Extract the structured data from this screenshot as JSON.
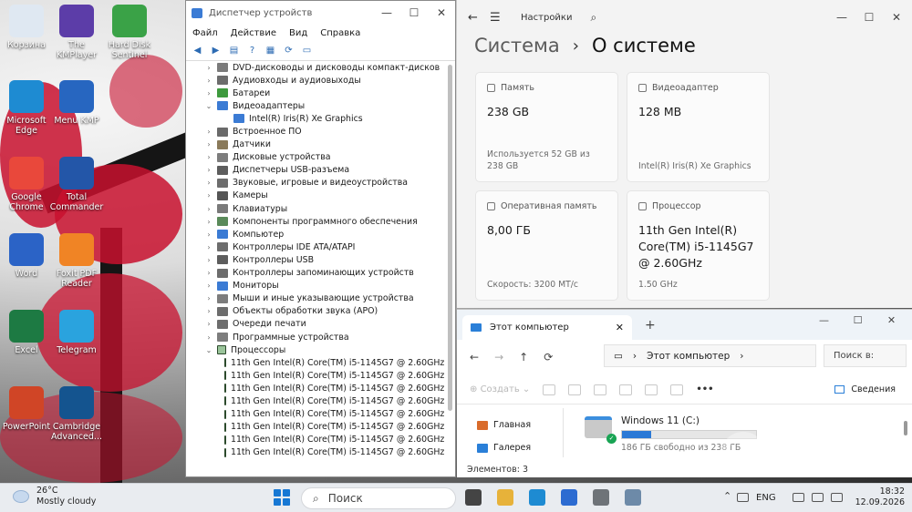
{
  "desktop": {
    "icons": [
      {
        "label": "Корзина",
        "color": "#dfe8f2"
      },
      {
        "label": "The KMPlayer",
        "color": "#5c3da8"
      },
      {
        "label": "Hard Disk Sentinel",
        "color": "#3aa247"
      },
      {
        "label": "Microsoft Edge",
        "color": "#1e8bd2"
      },
      {
        "label": "Menu KMP",
        "color": "#2766c0"
      },
      {
        "label": "Google Chrome",
        "color": "#e9483b"
      },
      {
        "label": "Total Commander",
        "color": "#2356a8"
      },
      {
        "label": "Word",
        "color": "#2b63c6"
      },
      {
        "label": "Foxit PDF Reader",
        "color": "#f08425"
      },
      {
        "label": "Excel",
        "color": "#1d7a43"
      },
      {
        "label": "Telegram",
        "color": "#2aa3de"
      },
      {
        "label": "PowerPoint",
        "color": "#d04526"
      },
      {
        "label": "Cambridge Advanced...",
        "color": "#14548f"
      }
    ]
  },
  "device_manager": {
    "title": "Диспетчер устройств",
    "window_controls": {
      "minimize": "—",
      "maximize": "☐",
      "close": "✕"
    },
    "menu": [
      "Файл",
      "Действие",
      "Вид",
      "Справка"
    ],
    "toolbar_icons": [
      "back-arrow-icon",
      "forward-arrow-icon",
      "properties-icon",
      "help-icon",
      "grid-icon",
      "update-driver-icon",
      "scan-hardware-icon"
    ],
    "tree": [
      {
        "label": "DVD-дисководы и дисководы компакт-дисков",
        "expanded": false,
        "child": false,
        "color": "#7b7b7b"
      },
      {
        "label": "Аудиовходы и аудиовыходы",
        "expanded": false,
        "child": false,
        "color": "#6d6d6d"
      },
      {
        "label": "Батареи",
        "expanded": false,
        "child": false,
        "color": "#3e9a3e"
      },
      {
        "label": "Видеоадаптеры",
        "expanded": true,
        "child": false,
        "color": "#3b7bd4"
      },
      {
        "label": "Intel(R) Iris(R) Xe Graphics",
        "expanded": false,
        "child": true,
        "color": "#3b7bd4"
      },
      {
        "label": "Встроенное ПО",
        "expanded": false,
        "child": false,
        "color": "#6a6a6a"
      },
      {
        "label": "Датчики",
        "expanded": false,
        "child": false,
        "color": "#8a7a5a"
      },
      {
        "label": "Дисковые устройства",
        "expanded": false,
        "child": false,
        "color": "#7d7d7d"
      },
      {
        "label": "Диспетчеры USB-разъема",
        "expanded": false,
        "child": false,
        "color": "#5d5d5d"
      },
      {
        "label": "Звуковые, игровые и видеоустройства",
        "expanded": false,
        "child": false,
        "color": "#6d6d6d"
      },
      {
        "label": "Камеры",
        "expanded": false,
        "child": false,
        "color": "#555555"
      },
      {
        "label": "Клавиатуры",
        "expanded": false,
        "child": false,
        "color": "#7a7a7a"
      },
      {
        "label": "Компоненты программного обеспечения",
        "expanded": false,
        "child": false,
        "color": "#5a8a5a"
      },
      {
        "label": "Компьютер",
        "expanded": false,
        "child": false,
        "color": "#3b7bd4"
      },
      {
        "label": "Контроллеры IDE ATA/ATAPI",
        "expanded": false,
        "child": false,
        "color": "#6d6d6d"
      },
      {
        "label": "Контроллеры USB",
        "expanded": false,
        "child": false,
        "color": "#5d5d5d"
      },
      {
        "label": "Контроллеры запоминающих устройств",
        "expanded": false,
        "child": false,
        "color": "#6d6d6d"
      },
      {
        "label": "Мониторы",
        "expanded": false,
        "child": false,
        "color": "#3b7bd4"
      },
      {
        "label": "Мыши и иные указывающие устройства",
        "expanded": false,
        "child": false,
        "color": "#7d7d7d"
      },
      {
        "label": "Объекты обработки звука (APO)",
        "expanded": false,
        "child": false,
        "color": "#6d6d6d"
      },
      {
        "label": "Очереди печати",
        "expanded": false,
        "child": false,
        "color": "#6d6d6d"
      },
      {
        "label": "Программные устройства",
        "expanded": false,
        "child": false,
        "color": "#7d7d7d"
      },
      {
        "label": "Процессоры",
        "expanded": true,
        "child": false,
        "color": "cpu"
      },
      {
        "label": "11th Gen Intel(R) Core(TM) i5-1145G7 @ 2.60GHz",
        "expanded": false,
        "child": true,
        "color": "cpu"
      },
      {
        "label": "11th Gen Intel(R) Core(TM) i5-1145G7 @ 2.60GHz",
        "expanded": false,
        "child": true,
        "color": "cpu"
      },
      {
        "label": "11th Gen Intel(R) Core(TM) i5-1145G7 @ 2.60GHz",
        "expanded": false,
        "child": true,
        "color": "cpu"
      },
      {
        "label": "11th Gen Intel(R) Core(TM) i5-1145G7 @ 2.60GHz",
        "expanded": false,
        "child": true,
        "color": "cpu"
      },
      {
        "label": "11th Gen Intel(R) Core(TM) i5-1145G7 @ 2.60GHz",
        "expanded": false,
        "child": true,
        "color": "cpu"
      },
      {
        "label": "11th Gen Intel(R) Core(TM) i5-1145G7 @ 2.60GHz",
        "expanded": false,
        "child": true,
        "color": "cpu"
      },
      {
        "label": "11th Gen Intel(R) Core(TM) i5-1145G7 @ 2.60GHz",
        "expanded": false,
        "child": true,
        "color": "cpu"
      },
      {
        "label": "11th Gen Intel(R) Core(TM) i5-1145G7 @ 2.60GHz",
        "expanded": false,
        "child": true,
        "color": "cpu"
      }
    ]
  },
  "settings": {
    "app_title": "Настройки",
    "back_icon": "←",
    "menu_icon": "☰",
    "search_icon": "⌕",
    "breadcrumb_parent": "Система",
    "breadcrumb_separator": "›",
    "breadcrumb_current": "О системе",
    "cards": {
      "storage": {
        "label": "Память",
        "value": "238 GB",
        "sub": "Используется 52 GB из 238 GB"
      },
      "gpu": {
        "label": "Видеоадаптер",
        "value": "128 MB",
        "sub": "Intel(R) Iris(R) Xe Graphics"
      },
      "ram": {
        "label": "Оперативная память",
        "value": "8,00 ГБ",
        "sub": "Скорость: 3200 МТ/с"
      },
      "cpu": {
        "label": "Процессор",
        "value": "11th Gen Intel(R) Core(TM) i5-1145G7 @ 2.60GHz",
        "sub": "1.50 GHz"
      }
    }
  },
  "explorer": {
    "tab_title": "Этот компьютер",
    "tab_close": "✕",
    "new_tab": "+",
    "window_controls": {
      "minimize": "—",
      "maximize": "☐",
      "close": "✕"
    },
    "nav": {
      "back": "←",
      "forward": "→",
      "up": "↑",
      "refresh": "⟳"
    },
    "address": "Этот компьютер",
    "address_sep": "›",
    "search_placeholder": "Поиск в:",
    "toolbar": {
      "create": "Создать",
      "more": "•••",
      "details": "Сведения"
    },
    "nav_pane": [
      {
        "label": "Главная",
        "color": "#d96b2b"
      },
      {
        "label": "Галерея",
        "color": "#2a7fd8"
      }
    ],
    "drive": {
      "name": "Windows 11 (C:)",
      "free_text": "186 ГБ свободно из 238 ГБ",
      "used_fraction": 0.22
    },
    "status": "Элементов: 3"
  },
  "taskbar": {
    "weather_temp": "26°C",
    "weather_desc": "Mostly cloudy",
    "search_placeholder": "Поиск",
    "apps": [
      {
        "name": "task-view-icon",
        "color": "#444444"
      },
      {
        "name": "file-explorer-icon",
        "color": "#e7b23a"
      },
      {
        "name": "edge-icon",
        "color": "#1e8bd2"
      },
      {
        "name": "store-icon",
        "color": "#2c6bd1"
      },
      {
        "name": "settings-gear-icon",
        "color": "#6e7378"
      },
      {
        "name": "device-manager-icon",
        "color": "#6d8aa8"
      }
    ],
    "language": "ENG",
    "time": "18:32",
    "date": "12.09.2026"
  }
}
